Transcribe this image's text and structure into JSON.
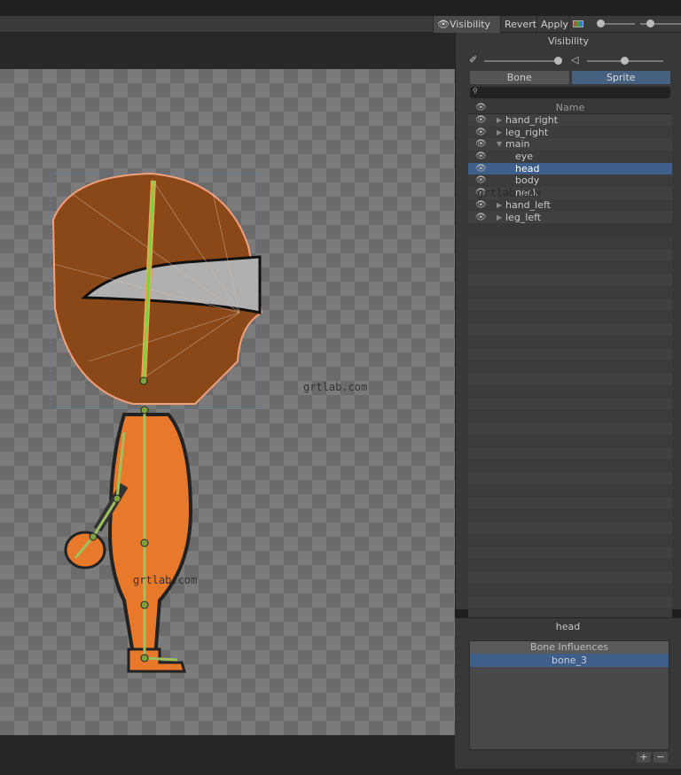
{
  "toolbar": {
    "visibility_label": "Visibility",
    "revert_label": "Revert",
    "apply_label": "Apply"
  },
  "visibility_panel": {
    "title": "Visibility",
    "bone_opacity": 0.95,
    "sprite_opacity": 0.55,
    "tabs": [
      {
        "label": "Bone",
        "active": false
      },
      {
        "label": "Sprite",
        "active": true
      }
    ],
    "search": {
      "value": ""
    },
    "column_name": "Name",
    "rows": [
      {
        "label": "hand_right",
        "indent": 0,
        "expander": "collapsed",
        "selected": false
      },
      {
        "label": "leg_right",
        "indent": 0,
        "expander": "collapsed",
        "selected": false
      },
      {
        "label": "main",
        "indent": 0,
        "expander": "expanded",
        "selected": false
      },
      {
        "label": "eye",
        "indent": 1,
        "expander": "none",
        "selected": false
      },
      {
        "label": "head",
        "indent": 1,
        "expander": "none",
        "selected": true
      },
      {
        "label": "body",
        "indent": 1,
        "expander": "none",
        "selected": false
      },
      {
        "label": "neck",
        "indent": 1,
        "expander": "none",
        "selected": false
      },
      {
        "label": "hand_left",
        "indent": 0,
        "expander": "collapsed",
        "selected": false
      },
      {
        "label": "leg_left",
        "indent": 0,
        "expander": "collapsed",
        "selected": false
      }
    ]
  },
  "influence_panel": {
    "title": "head",
    "header": "Bone Influences",
    "items": [
      "bone_3"
    ],
    "add": "+",
    "remove": "−"
  },
  "watermark": "grtlab.com",
  "colors": {
    "selection": "#3e5f8a",
    "accent_orange": "#e8782a",
    "bone_green": "#7fd23a"
  }
}
